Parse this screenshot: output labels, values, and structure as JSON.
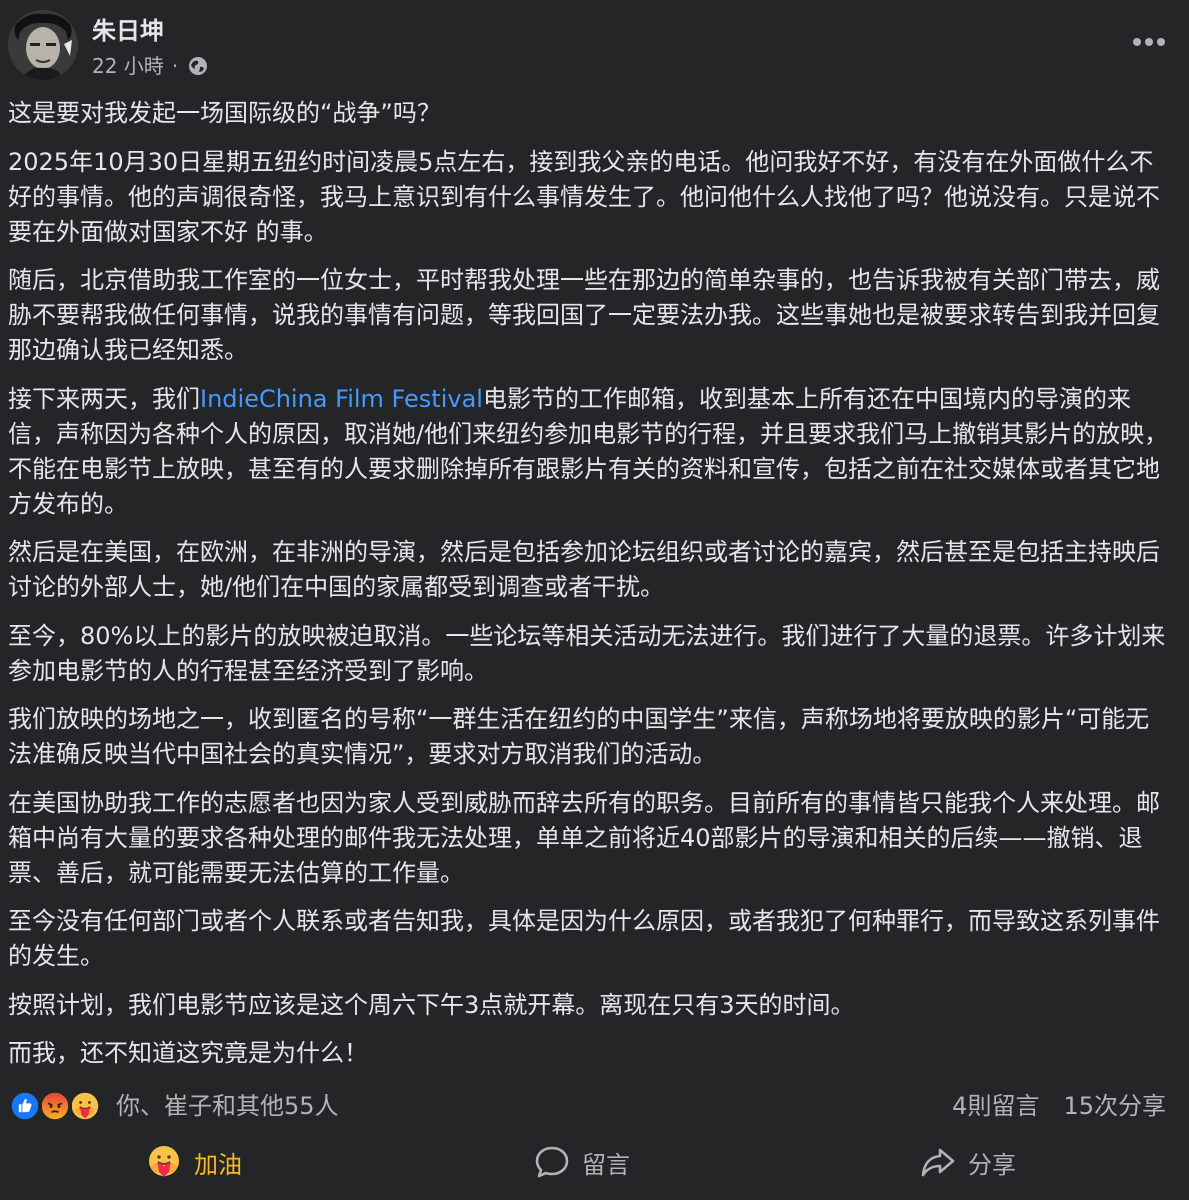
{
  "post": {
    "author": "朱日坤",
    "time": "22 小時",
    "separator": "·",
    "paragraphs": [
      "这是要对我发起一场国际级的“战争”吗？",
      "2025年10月30日星期五纽约时间凌晨5点左右，接到我父亲的电话。他问我好不好，有没有在外面做什么不好的事情。他的声调很奇怪，我马上意识到有什么事情发生了。他问他什么人找他了吗？他说没有。只是说不要在外面做对国家不好 的事。",
      "随后，北京借助我工作室的一位女士，平时帮我处理一些在那边的简单杂事的，也告诉我被有关部门带去，威胁不要帮我做任何事情，说我的事情有问题，等我回国了一定要法办我。这些事她也是被要求转告到我并回复那边确认我已经知悉。",
      "然后是在美国，在欧洲，在非洲的导演，然后是包括参加论坛组织或者讨论的嘉宾，然后甚至是包括主持映后讨论的外部人士，她/他们在中国的家属都受到调查或者干扰。",
      "至今，80%以上的影片的放映被迫取消。一些论坛等相关活动无法进行。我们进行了大量的退票。许多计划来参加电影节的人的行程甚至经济受到了影响。",
      "我们放映的场地之一，收到匿名的号称“一群生活在纽约的中国学生”来信，声称场地将要放映的影片“可能无法准确反映当代中国社会的真实情况”，要求对方取消我们的活动。",
      "在美国协助我工作的志愿者也因为家人受到威胁而辞去所有的职务。目前所有的事情皆只能我个人来处理。邮箱中尚有大量的要求各种处理的邮件我无法处理，单单之前将近40部影片的导演和相关的后续——撤销、退票、善后，就可能需要无法估算的工作量。",
      "至今没有任何部门或者个人联系或者告知我，具体是因为什么原因，或者我犯了何种罪行，而导致这系列事件的发生。",
      "按照计划，我们电影节应该是这个周六下午3点就开幕。离现在只有3天的时间。",
      "而我，还不知道这究竟是为什么！"
    ],
    "festival_paragraph": {
      "before": "接下来两天，我们",
      "link": "IndieChina Film Festival",
      "after": "电影节的工作邮箱，收到基本上所有还在中国境内的导演的来信，声称因为各种个人的原因，取消她/他们来纽约参加电影节的行程，并且要求我们马上撤销其影片的放映，不能在电影节上放映，甚至有的人要求删除掉所有跟影片有关的资料和宣传，包括之前在社交媒体或者其它地方发布的。"
    },
    "link_color": "#4599ff"
  },
  "reactions": {
    "icons": [
      "like-icon",
      "angry-icon",
      "care-icon"
    ],
    "summary": "你、崔子和其他55人",
    "comments": "4則留言",
    "shares": "15次分享"
  },
  "actions": {
    "care_label": "加油",
    "comment_label": "留言",
    "share_label": "分享",
    "active_color": "#f7b928"
  }
}
